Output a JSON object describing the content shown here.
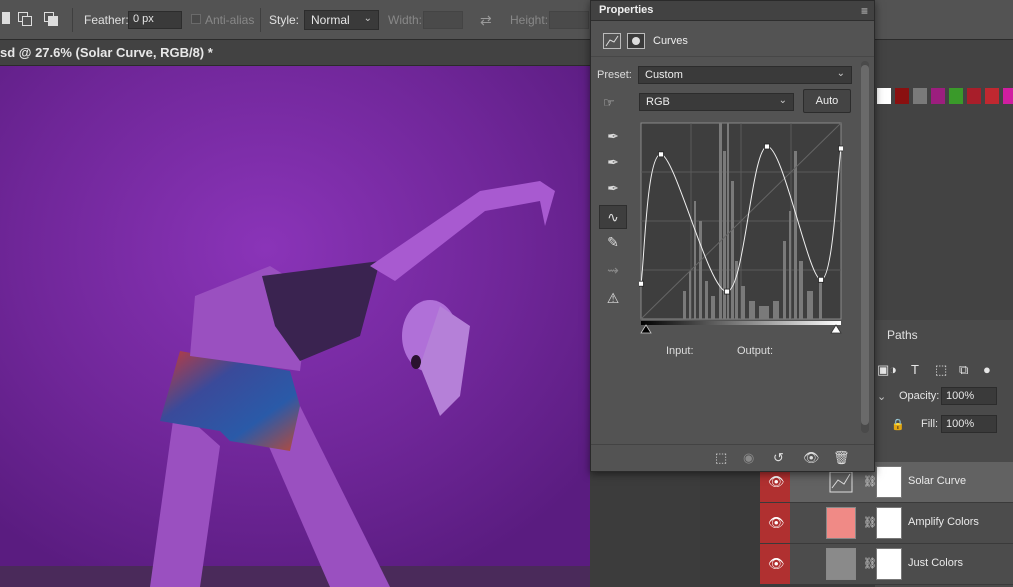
{
  "options_bar": {
    "feather_label": "Feather:",
    "feather_value": "0 px",
    "antialias_label": "Anti-alias",
    "style_label": "Style:",
    "style_value": "Normal",
    "width_label": "Width:",
    "height_label": "Height:"
  },
  "document_tab": {
    "title": "sd @ 27.6% (Solar Curve, RGB/8) *"
  },
  "properties": {
    "title": "Properties",
    "adjustment_name": "Curves",
    "preset_label": "Preset:",
    "preset_value": "Custom",
    "channel_value": "RGB",
    "auto_label": "Auto",
    "input_label": "Input:",
    "output_label": "Output:",
    "curve_points": [
      [
        0,
        0.18
      ],
      [
        0.1,
        0.84
      ],
      [
        0.43,
        0.14
      ],
      [
        0.63,
        0.88
      ],
      [
        0.9,
        0.2
      ],
      [
        1.0,
        0.87
      ]
    ]
  },
  "swatches": {
    "colors": [
      "#ffffff",
      "#8a1010",
      "#7a7a7a",
      "#9c1e7e",
      "#3a9a2a",
      "#a81e2a",
      "#c02830",
      "#d01ea0"
    ]
  },
  "layers_panel": {
    "tab_paths": "Paths",
    "opacity_label": "Opacity:",
    "opacity_value": "100%",
    "fill_label": "Fill:",
    "fill_value": "100%",
    "layers": [
      {
        "name": "Solar Curve",
        "selected": true,
        "thumb_color": "#ffffff"
      },
      {
        "name": "Amplify Colors",
        "selected": false,
        "thumb_color": "#f08a86"
      },
      {
        "name": "Just Colors",
        "selected": false,
        "thumb_color": "#8a8a8a"
      }
    ]
  },
  "colors": {
    "canvas_purple": "#6d2591",
    "panel_bg": "#535353",
    "eye_red": "#b03030"
  }
}
